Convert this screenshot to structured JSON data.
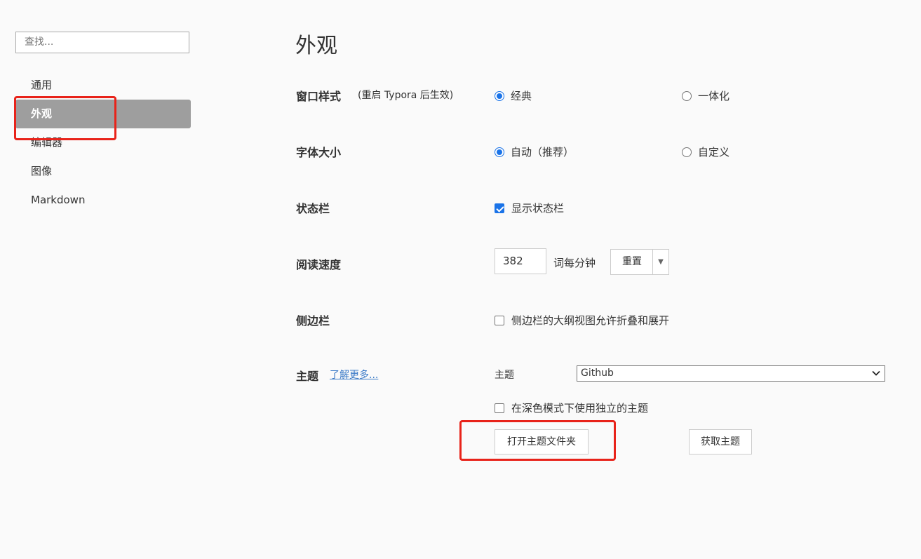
{
  "sidebar": {
    "search_placeholder": "查找...",
    "items": [
      {
        "label": "通用"
      },
      {
        "label": "外观"
      },
      {
        "label": "编辑器"
      },
      {
        "label": "图像"
      },
      {
        "label": "Markdown"
      }
    ],
    "active_index": 1
  },
  "main": {
    "title": "外观",
    "window_style": {
      "label": "窗口样式",
      "note": "(重启 Typora 后生效)",
      "option1": "经典",
      "option2": "一体化",
      "selected": "经典"
    },
    "font_size": {
      "label": "字体大小",
      "option1": "自动（推荐）",
      "option2": "自定义",
      "selected": "自动（推荐）"
    },
    "status_bar": {
      "label": "状态栏",
      "checkbox_label": "显示状态栏",
      "checked": true
    },
    "reading_speed": {
      "label": "阅读速度",
      "value": "382",
      "unit": "词每分钟",
      "reset_label": "重置",
      "dropdown_icon": "▼"
    },
    "sidebar_setting": {
      "label": "侧边栏",
      "checkbox_label": "侧边栏的大纲视图允许折叠和展开",
      "checked": false
    },
    "theme": {
      "label": "主题",
      "learn_more": "了解更多...",
      "select_label": "主题",
      "selected_theme": "Github",
      "dark_mode_label": "在深色模式下使用独立的主题",
      "dark_mode_checked": false,
      "open_folder_label": "打开主题文件夹",
      "get_themes_label": "获取主题"
    }
  },
  "colors": {
    "accent": "#1a73e8",
    "active_nav": "#9e9e9e",
    "highlight": "#e8231a",
    "link": "#3b7ac7"
  }
}
